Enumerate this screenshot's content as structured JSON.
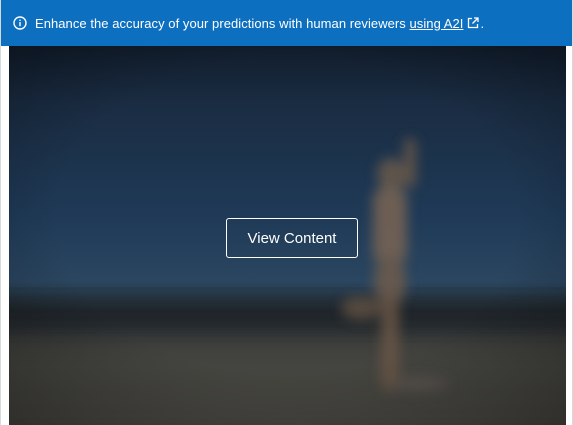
{
  "banner": {
    "icon": "info-icon",
    "text": "Enhance the accuracy of your predictions with human reviewers ",
    "link_text": "using A2I",
    "link_icon": "external-link-icon",
    "suffix": ".",
    "background_color": "#0d6fbf"
  },
  "content": {
    "state": "blurred",
    "view_button_label": "View Content"
  }
}
